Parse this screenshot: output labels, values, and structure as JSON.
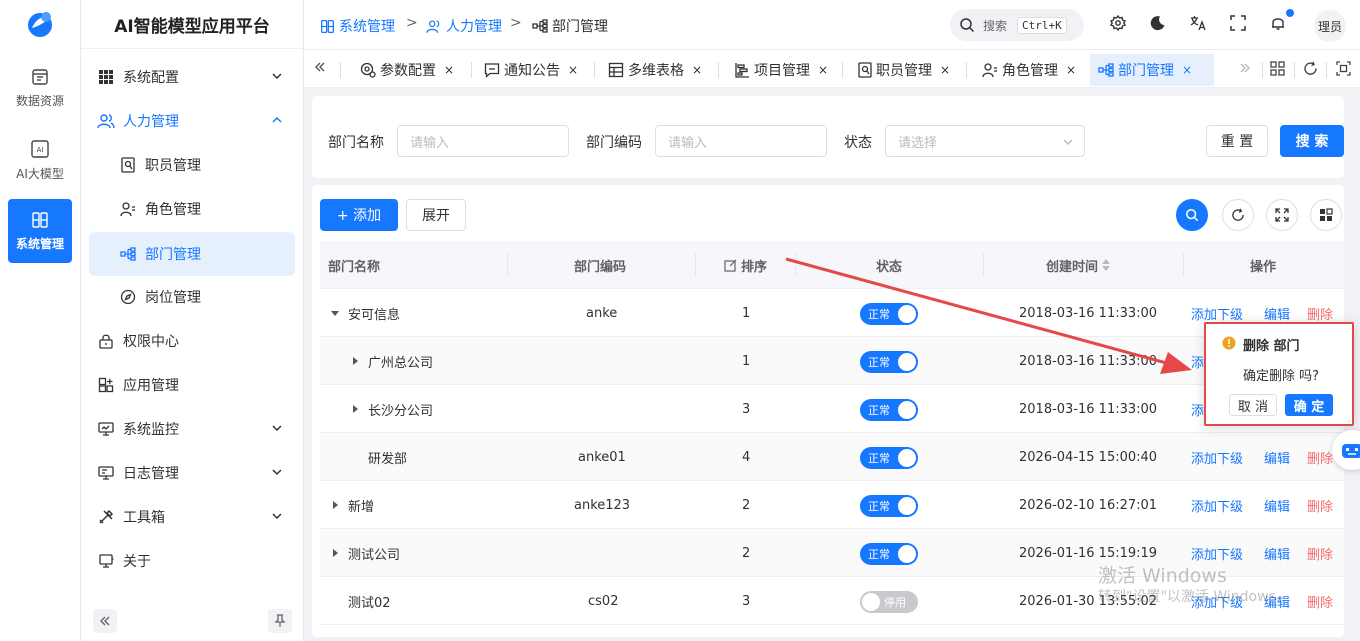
{
  "app": {
    "title": "AI智能模型应用平台"
  },
  "rail": {
    "items": [
      {
        "label": "数据资源",
        "icon": "database-icon"
      },
      {
        "label": "AI大模型",
        "icon": "ai-chip-icon"
      },
      {
        "label": "系统管理",
        "icon": "system-icon",
        "active": true
      }
    ]
  },
  "menu": {
    "items": [
      {
        "label": "系统配置"
      },
      {
        "label": "人力管理"
      },
      {
        "label": "职员管理"
      },
      {
        "label": "角色管理"
      },
      {
        "label": "部门管理"
      },
      {
        "label": "岗位管理"
      },
      {
        "label": "权限中心"
      },
      {
        "label": "应用管理"
      },
      {
        "label": "系统监控"
      },
      {
        "label": "日志管理"
      },
      {
        "label": "工具箱"
      },
      {
        "label": "关于"
      }
    ]
  },
  "breadcrumb": [
    "系统管理",
    "人力管理",
    "部门管理"
  ],
  "header": {
    "search_label": "搜索",
    "search_shortcut": "Ctrl+K",
    "avatar_text": "理员"
  },
  "tabs": [
    {
      "label": "参数配置"
    },
    {
      "label": "通知公告"
    },
    {
      "label": "多维表格"
    },
    {
      "label": "项目管理"
    },
    {
      "label": "职员管理"
    },
    {
      "label": "角色管理"
    },
    {
      "label": "部门管理",
      "active": true
    }
  ],
  "tab_close": "×",
  "filter": {
    "dept_name_label": "部门名称",
    "dept_name_placeholder": "请输入",
    "dept_code_label": "部门编码",
    "dept_code_placeholder": "请输入",
    "status_label": "状态",
    "status_placeholder": "请选择",
    "reset_label": "重 置",
    "search_label": "搜 索"
  },
  "toolbar": {
    "add_label": "+ 添加",
    "expand_label": "展开"
  },
  "table": {
    "columns": [
      "部门名称",
      "部门编码",
      "排序",
      "状态",
      "创建时间",
      "操作"
    ],
    "rows": [
      {
        "name": "安可信息",
        "code": "anke",
        "sort": "1",
        "status": "正常",
        "created": "2018-03-16 11:33:00"
      },
      {
        "name": "广州总公司",
        "code": "",
        "sort": "1",
        "status": "正常",
        "created": "2018-03-16 11:33:00"
      },
      {
        "name": "长沙分公司",
        "code": "",
        "sort": "3",
        "status": "正常",
        "created": "2018-03-16 11:33:00"
      },
      {
        "name": "研发部",
        "code": "anke01",
        "sort": "4",
        "status": "正常",
        "created": "2026-04-15 15:00:40"
      },
      {
        "name": "新增",
        "code": "anke123",
        "sort": "2",
        "status": "正常",
        "created": "2026-02-10 16:27:01"
      },
      {
        "name": "测试公司",
        "code": "",
        "sort": "2",
        "status": "正常",
        "created": "2026-01-16 15:19:19"
      },
      {
        "name": "测试02",
        "code": "cs02",
        "sort": "3",
        "status": "停用",
        "created": "2026-01-30 13:55:02"
      }
    ],
    "actions": {
      "add_child": "添加下级",
      "edit": "编辑",
      "delete": "删除",
      "add_child_clipped": "添"
    }
  },
  "popconfirm": {
    "title": "删除 部门",
    "message": "确定删除 吗?",
    "cancel": "取 消",
    "confirm": "确 定"
  },
  "watermark": {
    "line1": "激活 Windows",
    "line2": "转到\"设置\"以激活 Windows。"
  },
  "colors": {
    "primary": "#1677ff",
    "danger": "#f56c6c",
    "annotation": "#e54848"
  }
}
